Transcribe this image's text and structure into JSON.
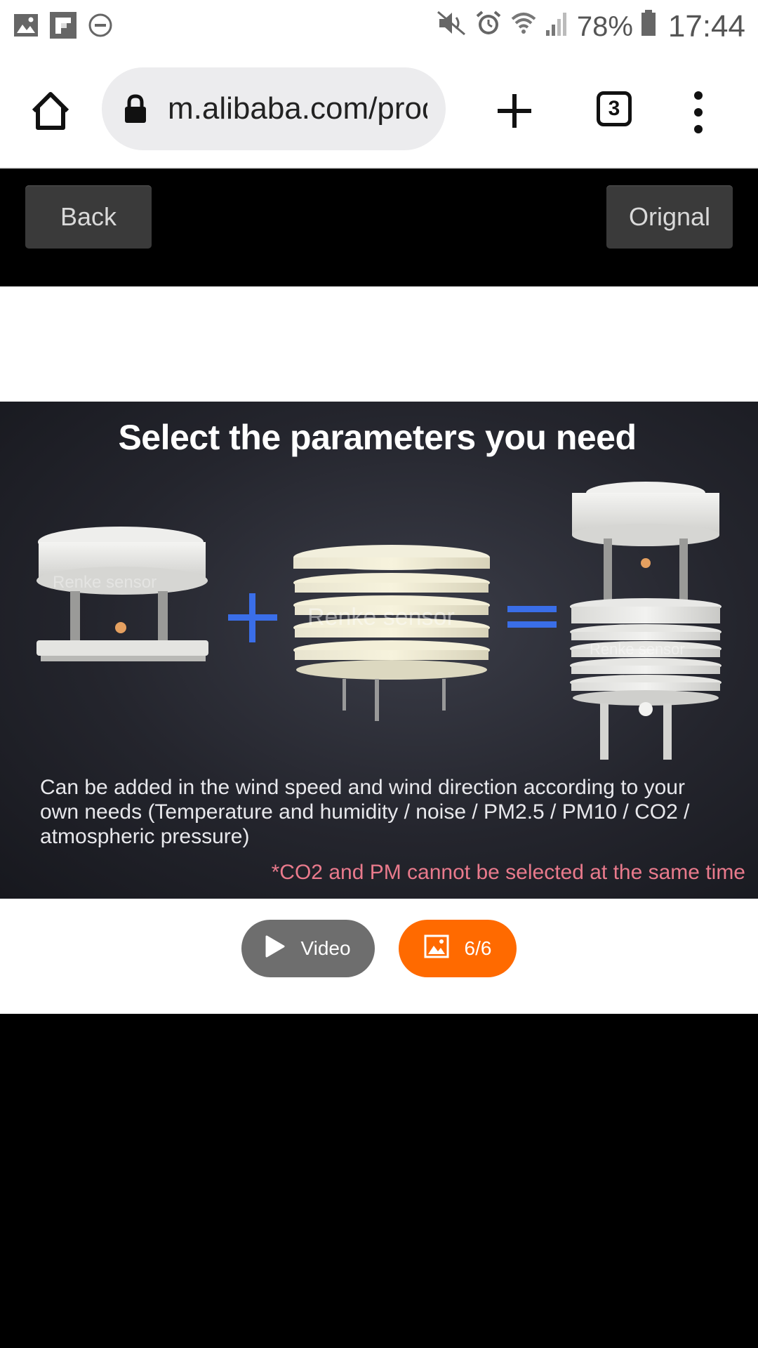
{
  "status_bar": {
    "left_icons": [
      "image-icon",
      "flipboard-icon",
      "do-not-disturb-icon"
    ],
    "right_icons": [
      "mute-icon",
      "alarm-icon",
      "wifi-icon",
      "signal-icon",
      "battery-icon"
    ],
    "battery": "78%",
    "time": "17:44"
  },
  "browser": {
    "url": "m.alibaba.com/product",
    "tab_count": "3"
  },
  "viewer": {
    "back_label": "Back",
    "original_label": "Orignal"
  },
  "product_image": {
    "title": "Select the parameters you need",
    "watermark": "Renke sensor",
    "description": "Can be added in the wind speed and wind direction according to your own needs (Temperature and humidity / noise / PM2.5 / PM10 / CO2 / atmospheric pressure)",
    "note": "*CO2 and PM cannot be selected at the same time",
    "operator_colors": {
      "plus": "#3a6ee8",
      "equals": "#3a6ee8"
    }
  },
  "controls": {
    "video_label": "Video",
    "image_counter": "6/6",
    "accent_color": "#ff6a00"
  }
}
